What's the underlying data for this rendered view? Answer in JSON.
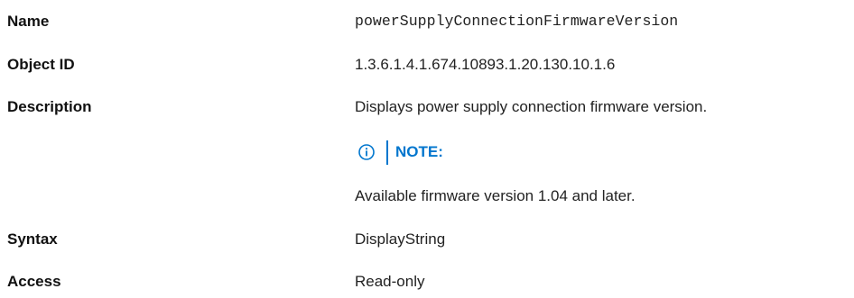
{
  "rows": {
    "name": {
      "label": "Name",
      "value": "powerSupplyConnectionFirmwareVersion"
    },
    "object_id": {
      "label": "Object ID",
      "value": "1.3.6.1.4.1.674.10893.1.20.130.10.1.6"
    },
    "description": {
      "label": "Description",
      "value": "Displays power supply connection firmware version.",
      "note": {
        "icon": "info-circle-icon",
        "title": "NOTE:",
        "text": "Available firmware version 1.04 and later."
      }
    },
    "syntax": {
      "label": "Syntax",
      "value": "DisplayString"
    },
    "access": {
      "label": "Access",
      "value": "Read-only"
    }
  },
  "colors": {
    "note_accent": "#0076ce",
    "text": "#111111"
  }
}
